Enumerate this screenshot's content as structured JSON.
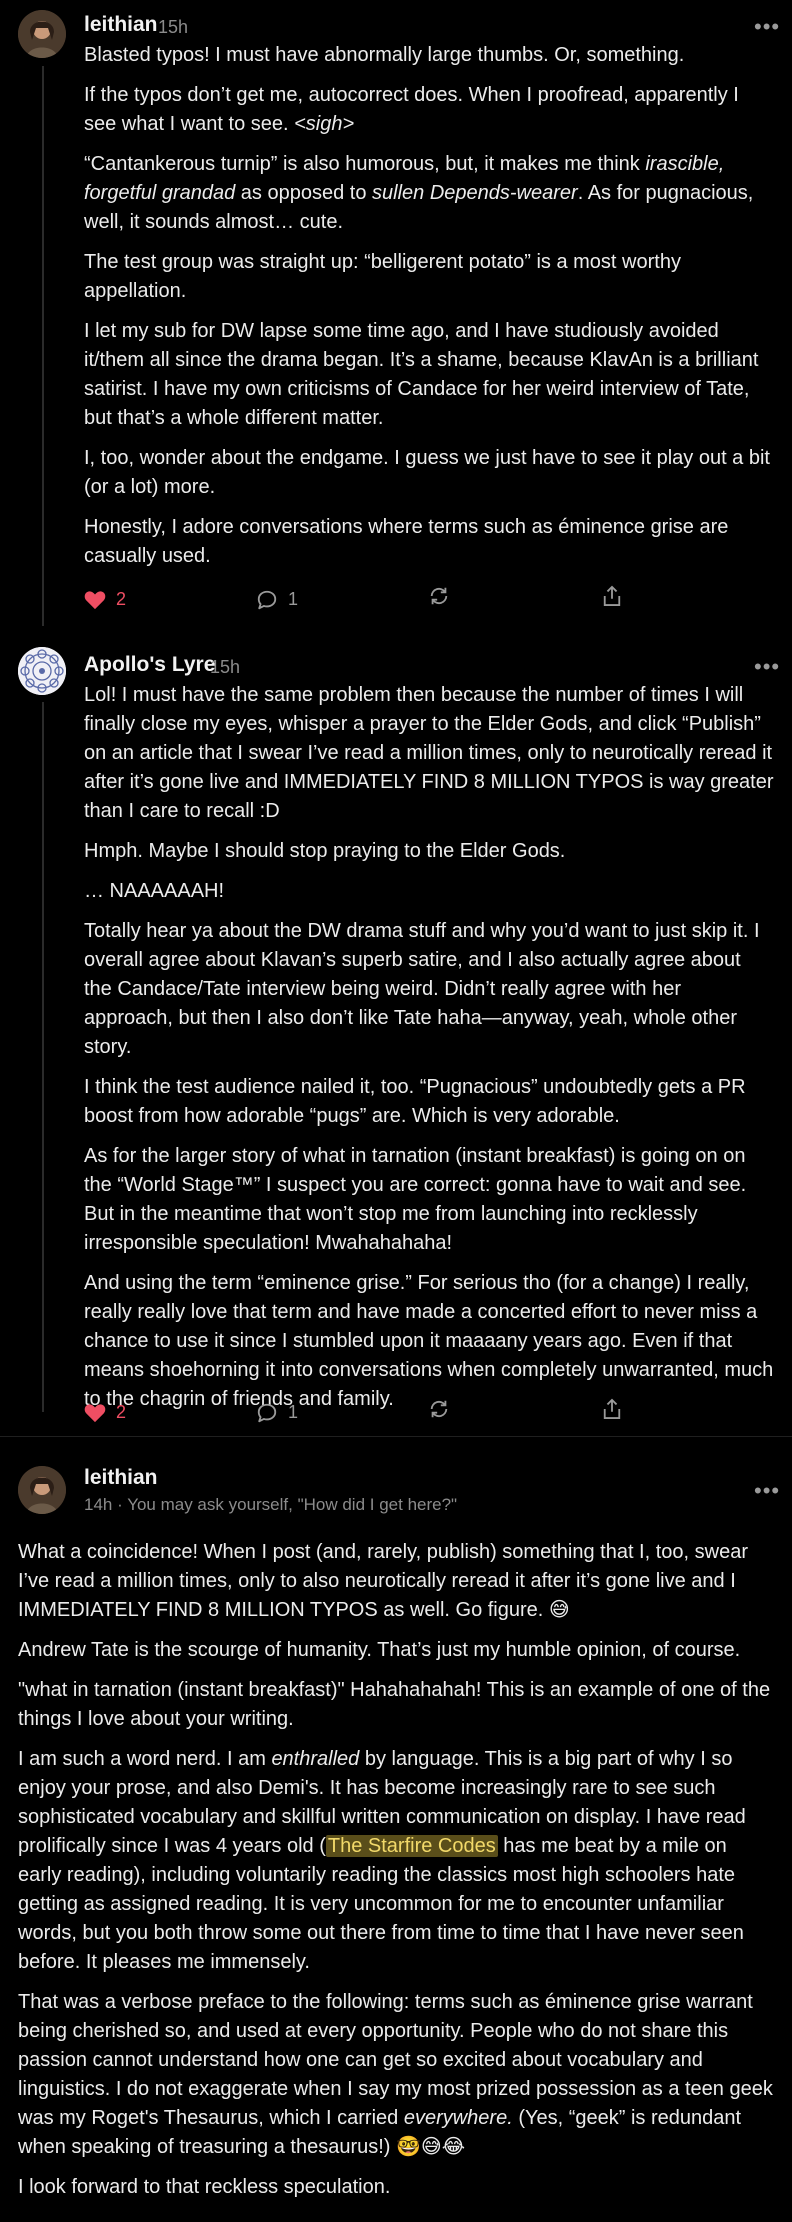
{
  "comments": [
    {
      "author": "leithian",
      "time": "15h",
      "paragraphs": [
        "Blasted typos! I must have abnormally large thumbs. Or, something.",
        "If the typos don’t get me, autocorrect does. When I proofread, apparently I see what I want to see. <sigh>",
        "“Cantankerous turnip” is also humorous, but, it makes me think irascible, forgetful grandad as opposed to sullen Depends-wearer. As for pugnacious, well, it sounds almost… cute.",
        "The test group was straight up: “belligerent potato” is a most worthy appellation.",
        "I let my sub for DW lapse some time ago, and I have studiously avoided it/them all since the drama began. It’s a shame, because KlavAn is a brilliant satirist. I have my own criticisms of Candace for her weird interview of Tate, but that’s a whole different matter.",
        "I, too, wonder about the endgame. I guess we just have to see it play out a bit (or a lot) more.",
        "Honestly, I adore conversations where terms such as éminence grise are casually used."
      ],
      "likes": "2",
      "replies": "1"
    },
    {
      "author": "Apollo's Lyre",
      "time": "15h",
      "paragraphs": [
        "Lol! I must have the same problem then because the number of times I will finally close my eyes, whisper a prayer to the Elder Gods, and click “Publish” on an article that I swear I’ve read a million times, only to neurotically reread it after it’s gone live and IMMEDIATELY FIND 8 MILLION TYPOS is way greater than I care to recall :D",
        "Hmph. Maybe I should stop praying to the Elder Gods.",
        "… NAAAAAAH!",
        "Totally hear ya about the DW drama stuff and why you’d want to just skip it. I overall agree about Klavan’s superb satire, and I also actually agree about the Candace/Tate interview being weird. Didn’t really agree with her approach, but then I also don’t like Tate haha—anyway, yeah, whole other story.",
        "I think the test audience nailed it, too. “Pugnacious” undoubtedly gets a PR boost from how adorable “pugs” are. Which is very adorable.",
        "As for the larger story of what in tarnation (instant breakfast) is going on on the “World Stage™” I suspect you are correct: gonna have to wait and see. But in the meantime that won’t stop me from launching into recklessly irresponsible speculation! Mwahahahaha!",
        "And using the term “eminence grise.” For serious tho (for a change) I really, really really love that term and have made a concerted effort to never miss a chance to use it since I stumbled upon it maaaany years ago. Even if that means shoehorning it into conversations when completely unwarranted, much to the chagrin of friends and family."
      ],
      "likes": "2",
      "replies": "1"
    },
    {
      "author": "leithian",
      "time": "14h",
      "subtitle": "You may ask yourself, \"How did I get here?\"",
      "paragraphs": [
        "What a coincidence! When I post (and, rarely, publish) something that I, too, swear I’ve read a million times, only to also neurotically reread it after it’s gone live and I IMMEDIATELY FIND 8 MILLION TYPOS as well. Go figure. 😅",
        "Andrew Tate is the scourge of humanity. That’s just my humble opinion, of course.",
        "\"what in tarnation (instant breakfast)\" Hahahahahah! This is an example of one of the things I love about your writing.",
        "I am such a word nerd. I am enthralled by language. This is a big part of why I so enjoy your prose, and also Demi's. It has become increasingly rare to see such sophisticated vocabulary and skillful written communication on display. I have read prolifically since I was 4 years old (",
        "That was a verbose preface to the following: terms such as éminence grise warrant being cherished so, and used at every opportunity. People who do not share this passion cannot understand how one can get so excited about vocabulary and linguistics. I do not exaggerate when I say my most prized possession as a teen geek was my Roget's Thesaurus, which I carried everywhere. (Yes, “geek” is redundant when speaking of treasuring a thesaurus!) 🤓😅😂",
        "I look forward to that reckless speculation."
      ],
      "link_text": "The Starfire Codes",
      "p4_rest": " has me beat by a mile on early reading), including voluntarily reading the classics most high schoolers hate getting as assigned reading. It is very uncommon for me to encounter unfamiliar words, but you both throw some out there from time to time that I have never seen before. It pleases me immensely."
    }
  ],
  "icons": {
    "like": "heart-icon",
    "reply": "comment-icon",
    "restack": "restack-icon",
    "share": "share-icon",
    "more": "more-icon"
  },
  "colors": {
    "like": "#ef4e63",
    "muted": "#8b8b8b",
    "highlight": "#f2d96a"
  }
}
